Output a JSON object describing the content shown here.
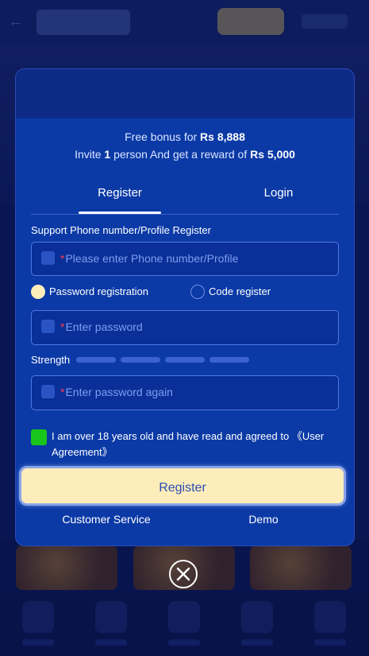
{
  "modal": {
    "bonus_prefix": "Free bonus for ",
    "bonus_amount": "Rs 8,888",
    "invite_prefix": "Invite ",
    "invite_count": "1",
    "invite_middle": " person And get a reward of ",
    "invite_reward": "Rs 5,000",
    "tabs": [
      {
        "label": "Register",
        "active": true
      },
      {
        "label": "Login",
        "active": false
      }
    ],
    "support_label": "Support Phone number/Profile Register",
    "phone_placeholder": "Please enter Phone number/Profile",
    "required_mark": "*",
    "radio_options": [
      {
        "label": "Password registration",
        "selected": true
      },
      {
        "label": "Code register",
        "selected": false
      }
    ],
    "password_placeholder": "Enter password",
    "strength_label": "Strength",
    "confirm_placeholder": "Enter password again",
    "agreement_text": "I am over 18 years old and have read and agreed to ",
    "agreement_link": "《User Agreement》",
    "agreement_checked": true,
    "register_button": "Register",
    "customer_service": "Customer Service",
    "demo": "Demo"
  },
  "colors": {
    "accent_button": "#fdedba",
    "checkbox": "#18c51b",
    "required_star": "#ff3a4f",
    "modal_bg": "#0b3aa6"
  },
  "icons": {
    "close": "close-circle-icon",
    "field": "field-icon"
  }
}
